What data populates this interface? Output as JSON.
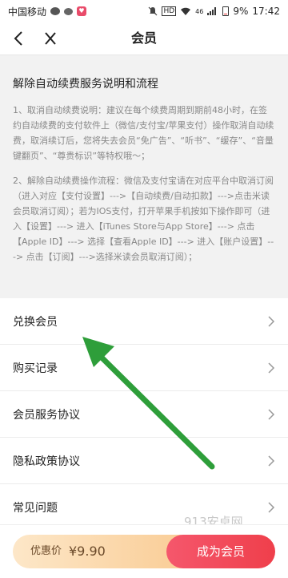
{
  "status_bar": {
    "carrier": "中国移动",
    "network": "4G",
    "battery": "9%",
    "time": "17:42",
    "signal_label": "46",
    "hd_label": "HD"
  },
  "header": {
    "title": "会员",
    "back_icon": "chevron-left-icon",
    "close_icon": "close-icon"
  },
  "info": {
    "title": "解除自动续费服务说明和流程",
    "para1": "1、取消自动续费说明：建议在每个续费周期到期前48小时，在签约自动续费的支付软件上（微信/支付宝/苹果支付）操作取消自动续费，取消续订后，您将失去会员“免广告”、“听书”、“缓存”、“音量键翻页”、“尊贵标识”等特权哦～；",
    "para2": "2、解除自动续费操作流程：微信及支付宝请在对应平台中取消订阅（进入对应【支付设置】--->【自动续费/自动扣款】--->点击米读会员取消订阅）；若为IOS支付，打开苹果手机按如下操作即可（进入【设置】---> 进入【iTunes Store与App Store】---> 点击【Apple ID】---> 选择【查看Apple ID】---> 进入【账户设置】---> 点击【订阅】--->选择米读会员取消订阅）；"
  },
  "menu": {
    "items": [
      {
        "label": "兑换会员"
      },
      {
        "label": "购买记录"
      },
      {
        "label": "会员服务协议"
      },
      {
        "label": "隐私政策协议"
      },
      {
        "label": "常见问题"
      }
    ]
  },
  "bottom": {
    "price_label": "优惠价",
    "price_value": "¥9.90",
    "join_label": "成为会员"
  },
  "watermark": "913安卓网",
  "colors": {
    "accent": "#ef3f4b",
    "annotation": "#2e9e3a",
    "price_bg": "#f9c98f"
  }
}
